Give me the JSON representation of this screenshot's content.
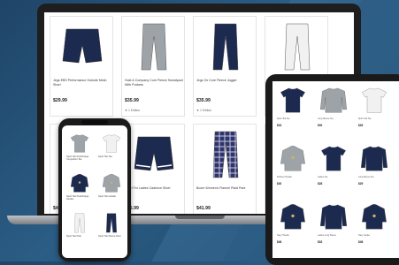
{
  "colors": {
    "navy": "#1c2a4f",
    "grey": "#9ea3a8",
    "white": "#f1f1f1",
    "plaid": "#3a3f7a"
  },
  "laptop": {
    "products": [
      {
        "name": "Jegs EBS Performance Outside Mesh Short",
        "price": "$29.99",
        "badge": "",
        "icon": "navy-shorts-icon"
      },
      {
        "name": "Hold & Company Core Fleece Sweatpant With Pockets",
        "price": "$35.99",
        "badge": "1 Edition",
        "icon": "grey-sweatpants-icon"
      },
      {
        "name": "Jegs Ox Core Fleece Jogger",
        "price": "$35.99",
        "badge": "1 Edition",
        "icon": "navy-jogger-icon"
      },
      {
        "name": "",
        "price": "",
        "badge": "",
        "icon": "white-sweatpants-icon"
      },
      {
        "name": "",
        "price": "$4",
        "badge": "",
        "icon": "hidden-product-icon"
      },
      {
        "name": "Sport For Ladies Cadence Short",
        "price": "$36.99",
        "badge": "",
        "icon": "navy-athletic-shorts-icon"
      },
      {
        "name": "Boxer Women's Flannel Plaid Pant",
        "price": "$41.99",
        "badge": "",
        "icon": "plaid-pants-icon"
      },
      {
        "name": "",
        "price": "",
        "badge": "",
        "icon": "blank-card"
      }
    ]
  },
  "phone": {
    "products": [
      {
        "name": "Sport Tek PosiCharge Competitor Tee",
        "icon": "grey-tee-icon"
      },
      {
        "name": "Sport Tek Tee",
        "icon": "white-tee-icon"
      },
      {
        "name": "Sport Tek PosiCharge Hoodie",
        "icon": "navy-jacket-icon"
      },
      {
        "name": "Sport Tek Hoodie",
        "icon": "grey-hoodie-icon"
      },
      {
        "name": "Sport Tek Pant",
        "icon": "white-sweatpants-icon"
      },
      {
        "name": "Sport Tek Fleece Pant",
        "icon": "navy-sweatpants-icon"
      }
    ]
  },
  "tablet": {
    "products": [
      {
        "name": "Sport Tek Tee",
        "price": "$32",
        "icon": "navy-tee-icon"
      },
      {
        "name": "Long Sleeve Tee",
        "price": "$30",
        "icon": "grey-longsleeve-icon"
      },
      {
        "name": "Sport Tek Tee",
        "price": "$26",
        "icon": "white-tee-icon"
      },
      {
        "name": "Pullover Hoodie",
        "price": "$40",
        "icon": "grey-hoodie-icon"
      },
      {
        "name": "Ladies Tee",
        "price": "$28",
        "icon": "navy-ladies-tee-icon"
      },
      {
        "name": "Long Sleeve Tee",
        "price": "$29",
        "icon": "navy-longsleeve-icon"
      },
      {
        "name": "Navy Hoodie",
        "price": "$46",
        "icon": "navy-hoodie-icon"
      },
      {
        "name": "Ladies Long Sleeve",
        "price": "$33",
        "icon": "navy-ladies-longsleeve-icon"
      },
      {
        "name": "Navy Jacket",
        "price": "$48",
        "icon": "navy-jacket-icon"
      }
    ]
  }
}
